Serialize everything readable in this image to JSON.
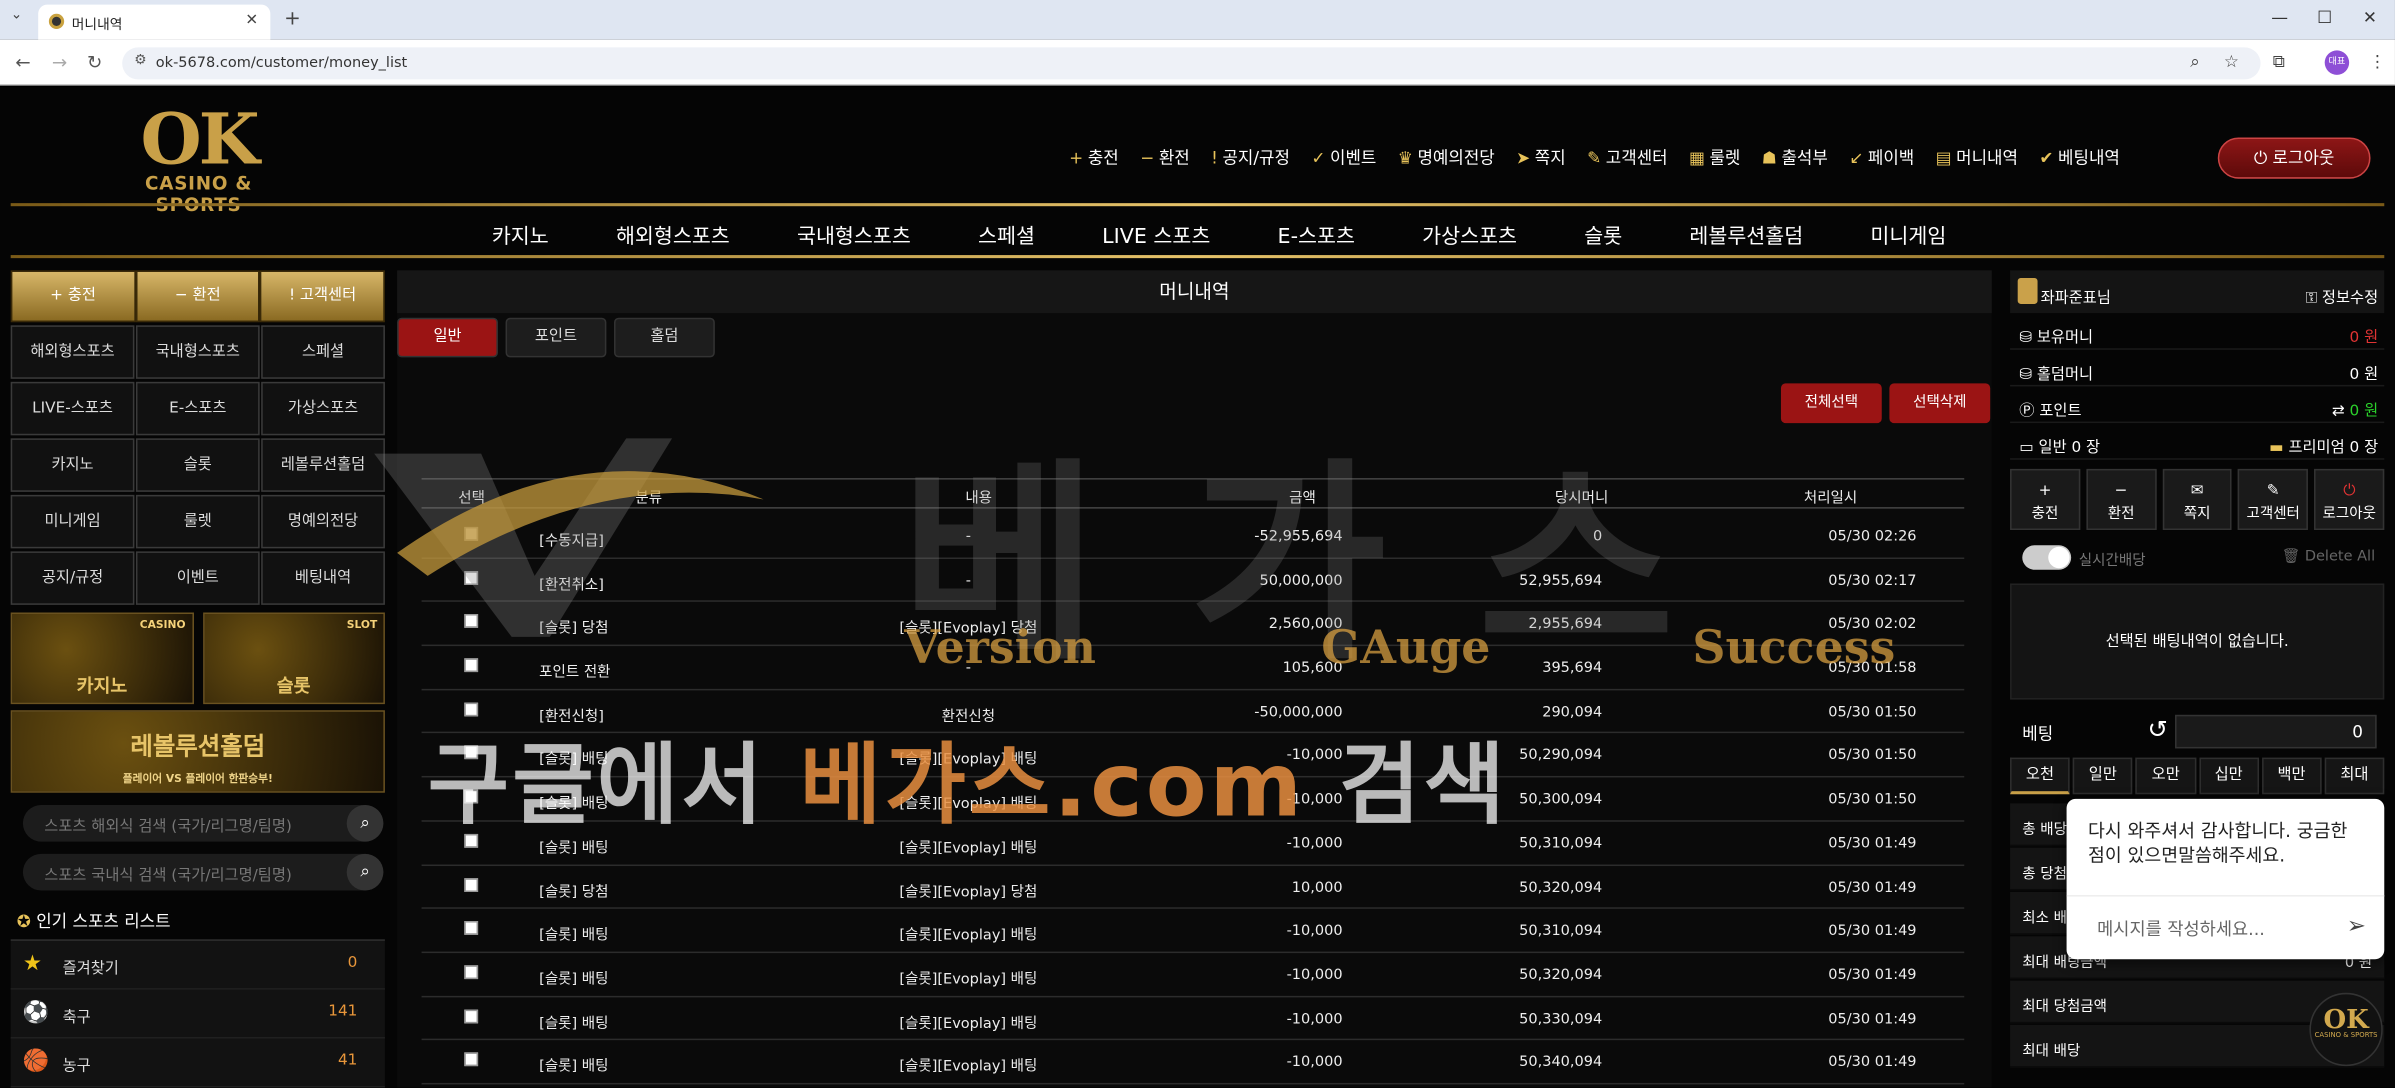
{
  "browser": {
    "tab_title": "머니내역",
    "url": "ok-5678.com/customer/money_list",
    "profile_badge": "대표"
  },
  "header": {
    "logo_main": "OK",
    "logo_sub": "CASINO & SPORTS",
    "top_nav": [
      {
        "icon": "+",
        "label": "충전"
      },
      {
        "icon": "−",
        "label": "환전"
      },
      {
        "icon": "!",
        "label": "공지/규정"
      },
      {
        "icon": "✓",
        "label": "이벤트"
      },
      {
        "icon": "♛",
        "label": "명예의전당"
      },
      {
        "icon": "➤",
        "label": "쪽지"
      },
      {
        "icon": "✎",
        "label": "고객센터"
      },
      {
        "icon": "▦",
        "label": "룰렛"
      },
      {
        "icon": "☗",
        "label": "출석부"
      },
      {
        "icon": "↙",
        "label": "페이백"
      },
      {
        "icon": "▤",
        "label": "머니내역"
      },
      {
        "icon": "✔",
        "label": "베팅내역"
      }
    ],
    "logout": "로그아웃",
    "main_nav": [
      "카지노",
      "해외형스포츠",
      "국내형스포츠",
      "스페셜",
      "LIVE 스포츠",
      "E-스포츠",
      "가상스포츠",
      "슬롯",
      "레볼루션홀덤",
      "미니게임"
    ]
  },
  "left": {
    "quick": [
      "충전",
      "환전",
      "고객센터"
    ],
    "menu": [
      "해외형스포츠",
      "국내형스포츠",
      "스페셜",
      "LIVE-스포츠",
      "E-스포츠",
      "가상스포츠",
      "카지노",
      "슬롯",
      "레볼루션홀덤",
      "미니게임",
      "룰렛",
      "명예의전당",
      "공지/규정",
      "이벤트",
      "베팅내역"
    ],
    "banner_casino": "카지노",
    "banner_casino_sub": "CASINO",
    "banner_slot": "슬롯",
    "banner_slot_sub": "SLOT",
    "banner_holdem": "레볼루션홀덤",
    "banner_holdem_sub": "플레이어 VS 플레이어 한판승부!",
    "search_overseas": "스포츠 해외식 검색 (국가/리그명/팀명)",
    "search_domestic": "스포츠 국내식 검색 (국가/리그명/팀명)",
    "popular_title": "인기 스포츠 리스트",
    "sports": [
      {
        "icon": "★",
        "label": "즐겨찾기",
        "count": "0"
      },
      {
        "icon": "⚽",
        "label": "축구",
        "count": "141"
      },
      {
        "icon": "🏀",
        "label": "농구",
        "count": "41"
      }
    ]
  },
  "center": {
    "title": "머니내역",
    "tabs": [
      "일반",
      "포인트",
      "홀덤"
    ],
    "select_all": "전체선택",
    "delete_selected": "선택삭제",
    "columns": [
      "선택",
      "분류",
      "내용",
      "금액",
      "당시머니",
      "처리일시"
    ],
    "rows": [
      [
        "[수동지급]",
        "-",
        "-52,955,694",
        "0",
        "05/30 02:26"
      ],
      [
        "[환전취소]",
        "-",
        "50,000,000",
        "52,955,694",
        "05/30 02:17"
      ],
      [
        "[슬롯] 당첨",
        "[슬롯][Evoplay] 당첨",
        "2,560,000",
        "2,955,694",
        "05/30 02:02"
      ],
      [
        "포인트 전환",
        "-",
        "105,600",
        "395,694",
        "05/30 01:58"
      ],
      [
        "[환전신청]",
        "환전신청",
        "-50,000,000",
        "290,094",
        "05/30 01:50"
      ],
      [
        "[슬롯] 배팅",
        "[슬롯][Evoplay] 배팅",
        "-10,000",
        "50,290,094",
        "05/30 01:50"
      ],
      [
        "[슬롯] 배팅",
        "[슬롯][Evoplay] 배팅",
        "-10,000",
        "50,300,094",
        "05/30 01:50"
      ],
      [
        "[슬롯] 배팅",
        "[슬롯][Evoplay] 배팅",
        "-10,000",
        "50,310,094",
        "05/30 01:49"
      ],
      [
        "[슬롯] 당첨",
        "[슬롯][Evoplay] 당첨",
        "10,000",
        "50,320,094",
        "05/30 01:49"
      ],
      [
        "[슬롯] 배팅",
        "[슬롯][Evoplay] 배팅",
        "-10,000",
        "50,310,094",
        "05/30 01:49"
      ],
      [
        "[슬롯] 배팅",
        "[슬롯][Evoplay] 배팅",
        "-10,000",
        "50,320,094",
        "05/30 01:49"
      ],
      [
        "[슬롯] 배팅",
        "[슬롯][Evoplay] 배팅",
        "-10,000",
        "50,330,094",
        "05/30 01:49"
      ],
      [
        "[슬롯] 배팅",
        "[슬롯][Evoplay] 배팅",
        "-10,000",
        "50,340,094",
        "05/30 01:49"
      ]
    ]
  },
  "watermark": {
    "big": "베가스",
    "word1": "Version",
    "word2": "GAuge",
    "word3": "Success",
    "search_pre": "구글에서 ",
    "search_site": "베가스.com",
    "search_post": " 검색"
  },
  "right": {
    "username": "좌파준표님",
    "edit": "정보수정",
    "balance_label": "보유머니",
    "balance_value": "0 원",
    "holdem_label": "홀덤머니",
    "holdem_value": "0 원",
    "point_label": "포인트",
    "point_value": "0 원",
    "ticket_label": "일반 0 장",
    "premium_label": "프리미엄 0 장",
    "buttons": [
      {
        "icon": "+",
        "label": "충전"
      },
      {
        "icon": "−",
        "label": "환전"
      },
      {
        "icon": "✉",
        "label": "쪽지"
      },
      {
        "icon": "✎",
        "label": "고객센터"
      },
      {
        "icon": "⏻",
        "label": "로그아웃"
      }
    ],
    "realtime": "실시간배당",
    "delete_all": "Delete All",
    "no_bets": "선택된 배팅내역이 없습니다.",
    "bet_label": "베팅",
    "bet_value": "0",
    "amounts": [
      "오천",
      "일만",
      "오만",
      "십만",
      "백만",
      "최대"
    ],
    "stats": [
      {
        "label": "총 배당",
        "value": ""
      },
      {
        "label": "총 당첨",
        "value": ""
      },
      {
        "label": "최소 배팅",
        "value": ""
      },
      {
        "label": "최대 배팅금액",
        "value": "0 원"
      },
      {
        "label": "최대 당첨금액",
        "value": ""
      },
      {
        "label": "최대 배당",
        "value": ""
      }
    ]
  },
  "chat": {
    "message": "다시 와주셔서 감사합니다. 궁금한 점이 있으면말씀해주세요.",
    "placeholder": "메시지를 작성하세요..."
  },
  "floating_logo": {
    "main": "OK",
    "sub": "CASINO & SPORTS"
  }
}
